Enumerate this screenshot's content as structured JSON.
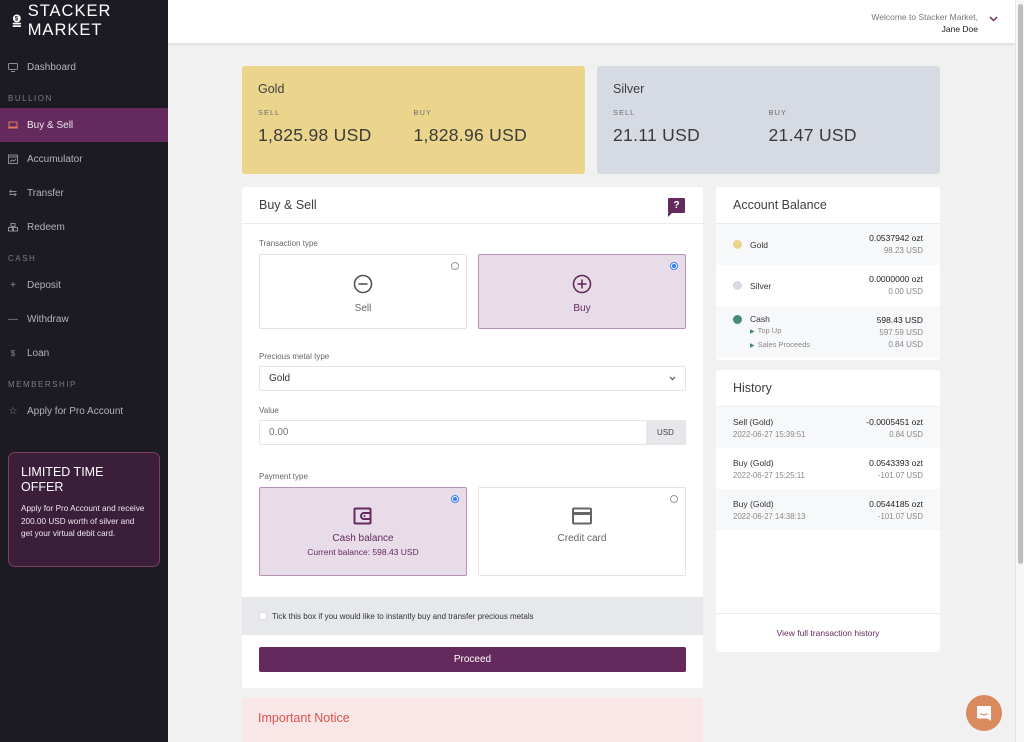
{
  "brand": {
    "name": "STACKER MARKET"
  },
  "header": {
    "welcome": "Welcome to Stacker Market,",
    "user_name": "Jane Doe"
  },
  "sidebar": {
    "dashboard": "Dashboard",
    "sections": [
      {
        "title": "BULLION",
        "items": [
          {
            "label": "Buy & Sell",
            "icon": "laptop-icon",
            "active": true
          },
          {
            "label": "Accumulator",
            "icon": "calendar-chart-icon"
          },
          {
            "label": "Transfer",
            "icon": "arrows-swap-icon"
          },
          {
            "label": "Redeem",
            "icon": "bars-stack-icon"
          }
        ]
      },
      {
        "title": "CASH",
        "items": [
          {
            "label": "Deposit",
            "icon": "plus-icon"
          },
          {
            "label": "Withdraw",
            "icon": "minus-icon"
          },
          {
            "label": "Loan",
            "icon": "dollar-icon"
          }
        ]
      },
      {
        "title": "MEMBERSHIP",
        "items": [
          {
            "label": "Apply for Pro Account",
            "icon": "star-icon"
          }
        ]
      }
    ],
    "offer": {
      "title": "LIMITED TIME OFFER",
      "text": "Apply for Pro Account and receive 200.00 USD worth of silver and get your virtual debit card."
    }
  },
  "prices": {
    "gold": {
      "title": "Gold",
      "sell_label": "SELL",
      "sell": "1,825.98 USD",
      "buy_label": "BUY",
      "buy": "1,828.96 USD"
    },
    "silver": {
      "title": "Silver",
      "sell_label": "SELL",
      "sell": "21.11 USD",
      "buy_label": "BUY",
      "buy": "21.47 USD"
    }
  },
  "buy_sell": {
    "title": "Buy & Sell",
    "help": "?",
    "transaction_type_label": "Transaction type",
    "transaction_options": [
      {
        "label": "Sell",
        "selected": false
      },
      {
        "label": "Buy",
        "selected": true
      }
    ],
    "metal_type_label": "Precious metal type",
    "metal_type_value": "Gold",
    "value_label": "Value",
    "value_placeholder": "0.00",
    "value_currency": "USD",
    "payment_type_label": "Payment type",
    "payment_options": [
      {
        "label": "Cash balance",
        "sub": "Current balance:  598.43 USD",
        "selected": true
      },
      {
        "label": "Credit card",
        "selected": false
      }
    ],
    "instant_checkbox_label": "Tick this box if you would like to instantly buy and transfer precious metals",
    "instant_checked": false,
    "proceed_label": "Proceed"
  },
  "notice": {
    "title": "Important Notice"
  },
  "account_balance": {
    "title": "Account Balance",
    "rows": [
      {
        "name": "Gold",
        "color": "#ebd58d",
        "main": "0.0537942 ozt",
        "sub": "98.23 USD"
      },
      {
        "name": "Silver",
        "color": "#d6dae2",
        "main": "0.0000000 ozt",
        "sub": "0.00 USD"
      },
      {
        "name": "Cash",
        "color": "#448c78",
        "main": "598.43 USD",
        "children": [
          {
            "name": "Top Up",
            "value": "597.59 USD"
          },
          {
            "name": "Sales Proceeds",
            "value": "0.84 USD"
          }
        ]
      }
    ]
  },
  "history": {
    "title": "History",
    "rows": [
      {
        "type": "Sell (Gold)",
        "date": "2022-06-27 15:39:51",
        "ozt": "-0.0005451 ozt",
        "usd": "0.84 USD"
      },
      {
        "type": "Buy (Gold)",
        "date": "2022-06-27 15:25:11",
        "ozt": "0.0543393 ozt",
        "usd": "-101.07 USD"
      },
      {
        "type": "Buy (Gold)",
        "date": "2022-06-27 14:38:13",
        "ozt": "0.0544185 ozt",
        "usd": "-101.07 USD"
      }
    ],
    "footer_link": "View full transaction history"
  },
  "colors": {
    "brand": "#642a5e",
    "gold": "#ebd58d",
    "silver": "#d6dae2",
    "cash": "#448c78",
    "chat": "#d98a5f"
  }
}
